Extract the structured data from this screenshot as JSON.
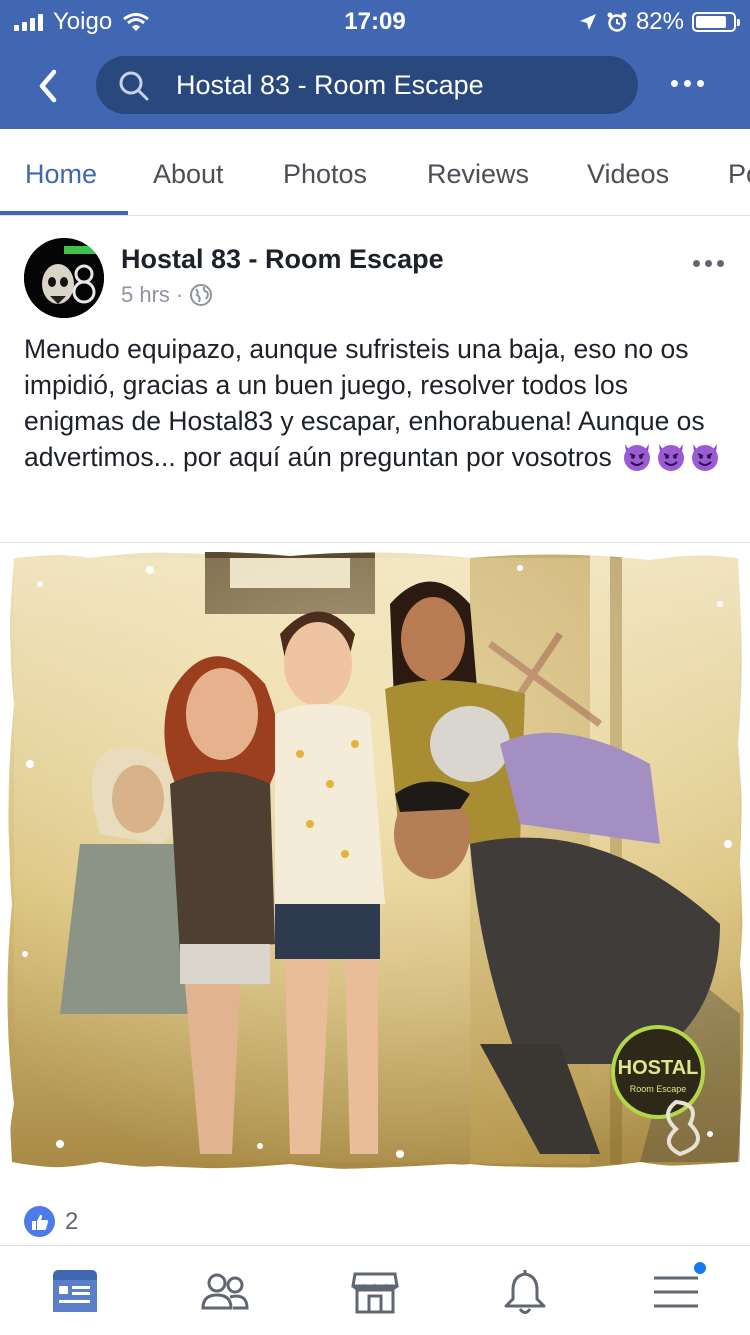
{
  "status_bar": {
    "carrier": "Yoigo",
    "time": "17:09",
    "battery": "82%",
    "battery_level": 0.82
  },
  "header": {
    "search_text": "Hostal 83 - Room Escape"
  },
  "tabs": [
    {
      "label": "Home",
      "active": true
    },
    {
      "label": "About",
      "active": false
    },
    {
      "label": "Photos",
      "active": false
    },
    {
      "label": "Reviews",
      "active": false
    },
    {
      "label": "Videos",
      "active": false
    },
    {
      "label": "Po",
      "active": false
    }
  ],
  "post": {
    "author": "Hostal 83 - Room Escape",
    "time": "5 hrs",
    "separator": "·",
    "text": "Menudo equipazo, aunque sufristeis una baja, eso no os impidió, gracias a un buen juego, resolver todos los enigmas de Hostal83 y escapar, enhorabuena! Aunque os advertimos... por aquí aún preguntan por vosotros",
    "emoji": [
      "smiling-imp",
      "smiling-imp",
      "smiling-imp"
    ],
    "photo": {
      "logo_text": "HOSTAL",
      "logo_sub": "Room Escape"
    },
    "like_count": "2"
  },
  "icons": {
    "back": "chevron-left-icon",
    "search": "search-icon",
    "more": "more-icon",
    "globe": "globe-icon",
    "like": "thumbs-up-icon",
    "feed": "news-feed-icon",
    "friends": "friends-icon",
    "marketplace": "marketplace-icon",
    "notifications": "bell-icon",
    "menu": "menu-icon"
  },
  "colors": {
    "brand": "#4267b2",
    "search_bg": "#29487d",
    "active_tab": "#4267b2",
    "like_badge": "#4e7bea",
    "notification_dot": "#1877f2"
  }
}
